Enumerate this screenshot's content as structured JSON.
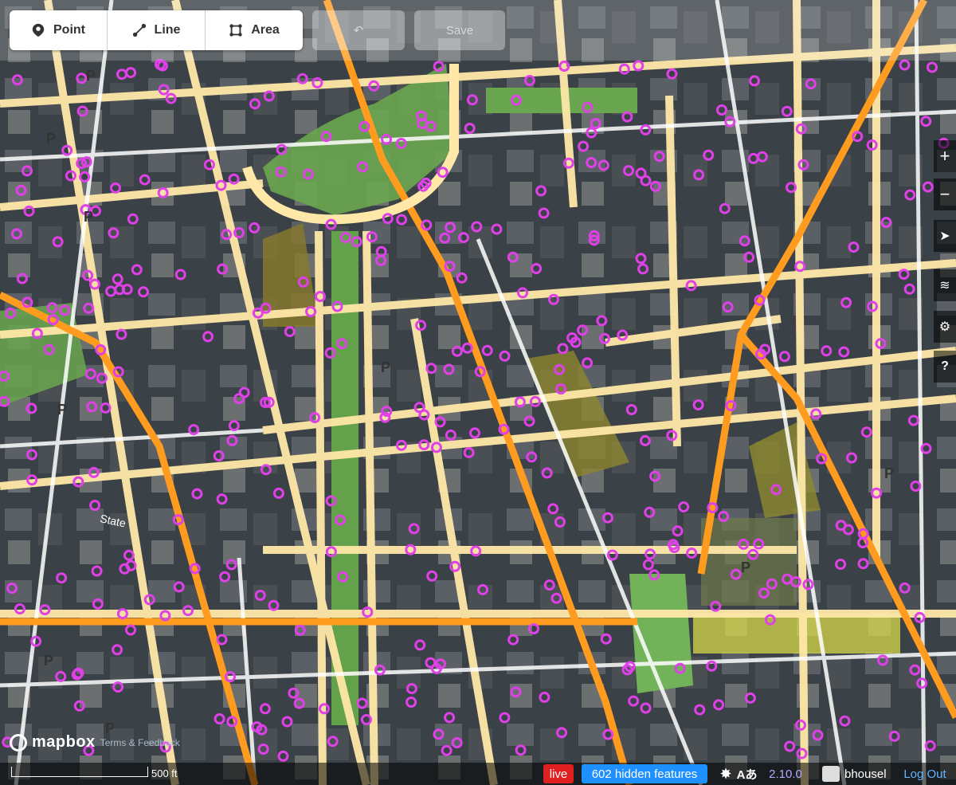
{
  "toolbar": {
    "modes": [
      {
        "label": "Point",
        "icon": "map-pin-icon"
      },
      {
        "label": "Line",
        "icon": "line-icon"
      },
      {
        "label": "Area",
        "icon": "area-icon"
      }
    ],
    "save_label": "Save"
  },
  "map_controls": [
    "zoom-in-icon",
    "zoom-out-icon",
    "locate-icon",
    "layers-icon",
    "map-data-icon",
    "help-icon"
  ],
  "zoom_in": "+",
  "zoom_out": "−",
  "help": "?",
  "map": {
    "street_label": "State",
    "parking_symbol": "P"
  },
  "footer": {
    "brand": "mapbox",
    "terms": "Terms & Feedback",
    "scale": "500 ft",
    "live": "live",
    "hidden_features": "602 hidden features",
    "issues_icon": "bug-icon",
    "locale_label": "Aあ",
    "version": "2.10.0",
    "username": "bhousel",
    "logout": "Log Out"
  },
  "colors": {
    "vertex": "#e040e8",
    "major_road": "#ff9b1f",
    "minor_road": "#ffe8a8",
    "park": "#7fc46b",
    "accent": "#1e90ff"
  }
}
